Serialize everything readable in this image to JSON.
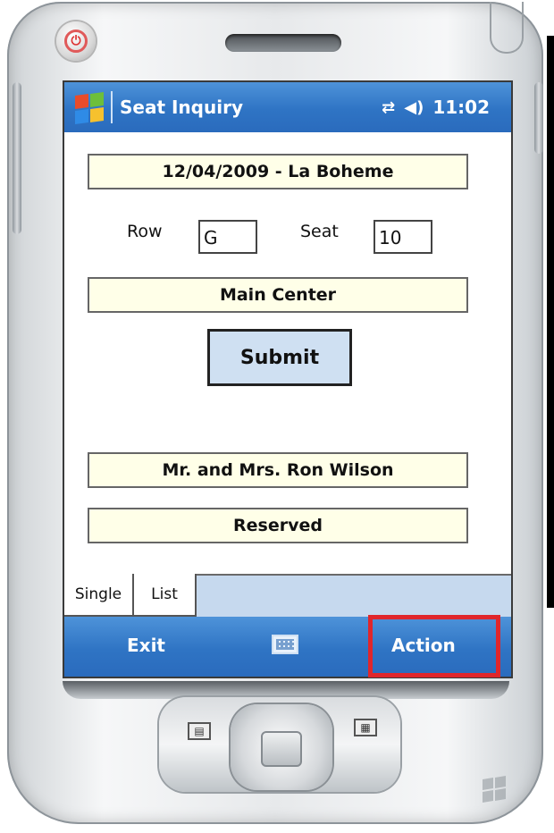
{
  "app": {
    "title": "Seat Inquiry",
    "time": "11:02"
  },
  "form": {
    "performance": "12/04/2009 - La Boheme",
    "row_label": "Row",
    "row_value": "G",
    "seat_label": "Seat",
    "seat_value": "10",
    "section": "Main Center",
    "submit_label": "Submit",
    "patron": "Mr. and Mrs. Ron Wilson",
    "status": "Reserved"
  },
  "tabs": [
    {
      "label": "Single",
      "selected": true
    },
    {
      "label": "List",
      "selected": false
    }
  ],
  "softkeys": {
    "left": "Exit",
    "right": "Action"
  },
  "icons": {
    "start": "windows-start-icon",
    "connectivity": "connectivity-arrows-icon",
    "volume": "volume-icon",
    "keyboard": "keyboard-icon",
    "power": "power-icon"
  },
  "colors": {
    "titlebar": "#2f74c4",
    "field_bg": "#ffffe8",
    "submit_bg": "#cfe0f2",
    "highlight": "#e0262b"
  }
}
